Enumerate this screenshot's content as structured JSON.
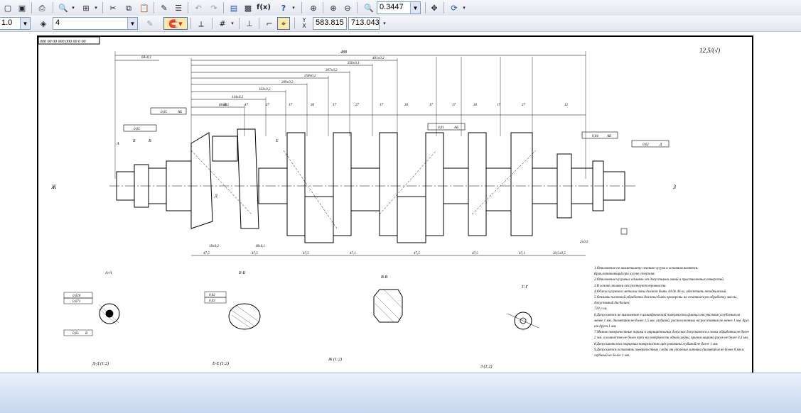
{
  "toolbar1": {
    "zoom_value": "0.3447",
    "fx_label": "f(x)",
    "help_label": "?"
  },
  "toolbar2": {
    "style_value": "1.0",
    "layer_value": "4",
    "y_label": "Y",
    "x_label": "X",
    "coord_x": "583.815",
    "coord_y": "713.043"
  },
  "drawing": {
    "stamp_text": "000 00 00 000 000 00 0 00",
    "roughness": "12,5/(√)",
    "dims_top": [
      "488",
      "401±0,2",
      "356±0,1",
      "307±0,2",
      "258±0,2",
      "209±0,2",
      "163±0,2",
      "114±0,2",
      "68±0,2",
      "68±0,1"
    ],
    "dims_row": [
      "30",
      "17",
      "27",
      "17",
      "30",
      "17",
      "27",
      "17",
      "30",
      "17",
      "17",
      "30",
      "17",
      "27",
      "12"
    ],
    "dims_bottom": [
      "47,5",
      "47,5",
      "47,5",
      "47,1",
      "47,5",
      "47,5",
      "47,1",
      "30,5±0,5"
    ],
    "bottom_small": [
      "18±0,2",
      "18±0,1",
      "2±0,3"
    ],
    "section_labels": [
      "А-А",
      "Б-Б",
      "В-В",
      "Г-Г",
      "Д-Д (1:2)",
      "Е-Е (1:2)",
      "Ж (1:2)",
      "З (1:2)"
    ],
    "view_letters": [
      "Ж",
      "З",
      "А",
      "Б",
      "В",
      "Д",
      "Е"
    ],
    "tolerances": [
      "0,05",
      "0,05",
      "0,04",
      "0,02",
      "0,03",
      "0,020",
      "0,071",
      "0,05",
      "0,01",
      "0,02"
    ],
    "datums": [
      "АБ",
      "АБ",
      "АБ",
      "Д",
      "В"
    ],
    "tech_notes": [
      "1.Отклонение по наименьшему сечению чугуна в основном является.",
      "Брак,возникающий при чугуне стержня.",
      "2.Отклонение чугунных отливок от допустимых линий и проставленных отверстий.",
      "3.В основе отливки отсутствуют неровности.",
      "4.Обжиг чугунного металла зоны должен быть 44 до 46 кг, обеспечить неподвижный.",
      "5.Отливки чистовой обработки должны быть проверены на статическую обработку массы, допустимый дисбаланс",
      "720 г·см.",
      "6.Допускается не выполнение в цилиндрической поверхности фланца отсутствия углубления на менее 1 мм. диаметром не более 1,5 мм. глубиной, расположенных на расстоянии не менее 1 мм. друг от друга 1 мм.",
      "7.Мелкие поверхностные пороки в отрицательных допусках допускаются в зонах обработки не более 2 мм. в количестве не более трех на поверхности одной шейки, причем ширина рисок не более 0,3 мм.",
      "8.Допускаются на торцевых поверхностях щёк раковины глубиной не более 1 мм.",
      "9.Допускается оставлять поверхностные следы от удаления литника диаметром не более 8 мм и глубиной не более 1 мм."
    ]
  },
  "colors": {
    "toolbar_top": "#f6f7fb",
    "toolbar_bottom": "#e2e6ee",
    "status_top": "#eaf1fb",
    "status_bottom": "#c7d7ef",
    "active_button": "#fde9a6"
  }
}
